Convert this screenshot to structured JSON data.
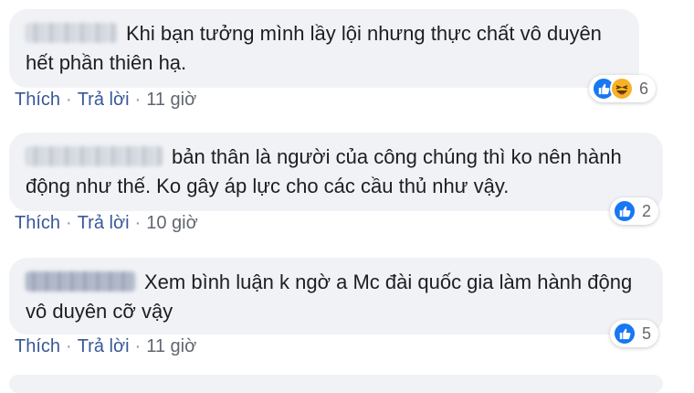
{
  "comments": [
    {
      "text": "Khi bạn tưởng mình lầy lội nhưng thực chất vô duyên hết phần thiên hạ.",
      "like_label": "Thích",
      "reply_label": "Trả lời",
      "time": "11 giờ",
      "reactions": [
        "like-icon",
        "haha-icon"
      ],
      "reaction_count": "6"
    },
    {
      "text": "bản thân là người của công chúng thì ko nên hành động như thế. Ko gây áp lực cho các cầu thủ như vậy.",
      "like_label": "Thích",
      "reply_label": "Trả lời",
      "time": "10 giờ",
      "reactions": [
        "like-icon"
      ],
      "reaction_count": "2"
    },
    {
      "text": "Xem bình luận k ngờ a Mc đài quốc gia làm hành động vô duyên cỡ vậy",
      "like_label": "Thích",
      "reply_label": "Trả lời",
      "time": "11 giờ",
      "reactions": [
        "like-icon"
      ],
      "reaction_count": "5"
    }
  ],
  "separator": "·",
  "colors": {
    "bubble": "#f0f2f5",
    "link": "#385898",
    "like": "#1877f2",
    "haha": "#f7b125"
  }
}
